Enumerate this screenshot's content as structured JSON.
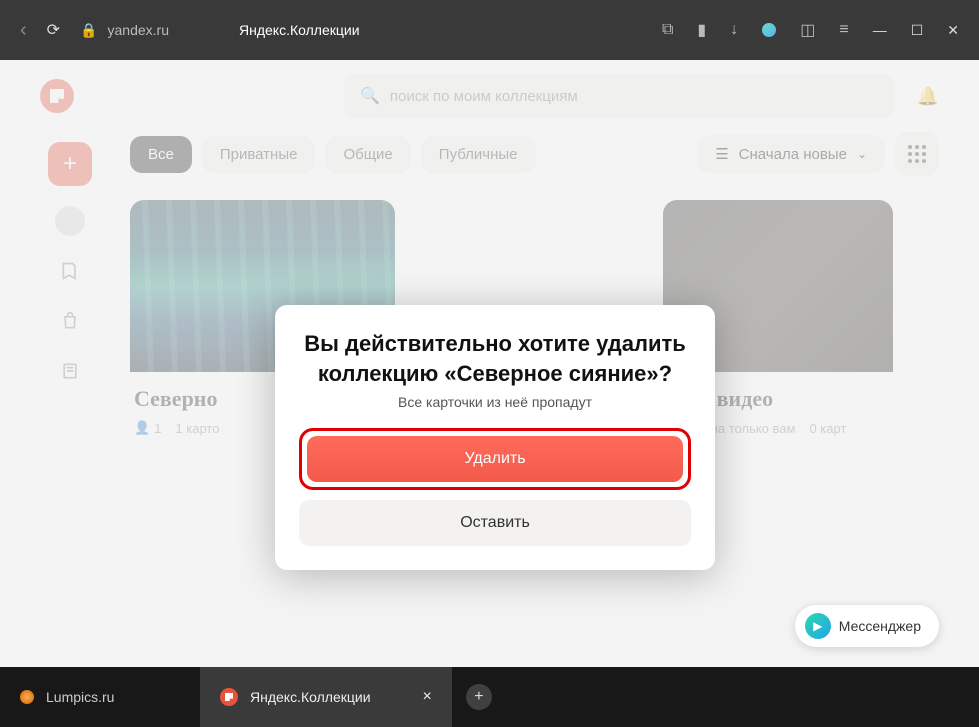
{
  "browser": {
    "url": "yandex.ru",
    "page_title": "Яндекс.Коллекции"
  },
  "header": {
    "search_placeholder": "поиск по моим коллекциям"
  },
  "filters": {
    "all": "Все",
    "private": "Приватные",
    "shared": "Общие",
    "public": "Публичные",
    "sort": "Сначала новые"
  },
  "cards": [
    {
      "title": "Северно",
      "people": "1",
      "count": "1 карто"
    },
    {
      "title": "Мои видео",
      "visibility": "Видна только вам",
      "count": "0 карт"
    }
  ],
  "modal": {
    "title_line1": "Вы действительно хотите удалить",
    "title_line2": "коллекцию «Северное сияние»?",
    "subtitle": "Все карточки из неё пропадут",
    "delete": "Удалить",
    "keep": "Оставить"
  },
  "messenger": "Мессенджер",
  "taskbar": {
    "tab1": "Lumpics.ru",
    "tab2": "Яндекс.Коллекции"
  }
}
